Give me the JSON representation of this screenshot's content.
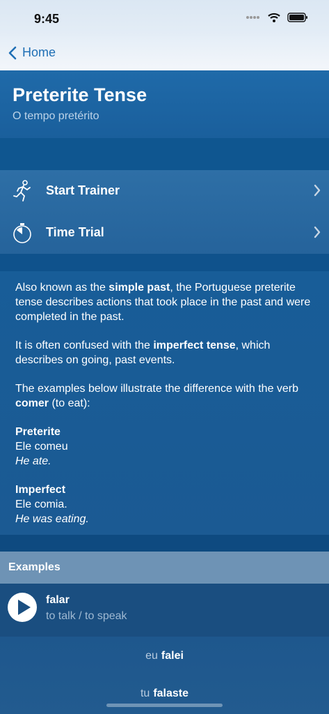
{
  "status": {
    "time": "9:45",
    "icons": [
      "signal-dots-icon",
      "wifi-icon",
      "battery-icon"
    ]
  },
  "nav": {
    "back_label": "Home",
    "back_icon": "chevron-left-icon"
  },
  "header": {
    "title": "Preterite Tense",
    "subtitle": "O tempo pretérito"
  },
  "menu": {
    "items": [
      {
        "label": "Start Trainer",
        "icon": "runner-icon"
      },
      {
        "label": "Time Trial",
        "icon": "stopwatch-icon"
      }
    ]
  },
  "description": {
    "p1": {
      "a": "Also known as the ",
      "b": "simple past",
      "c": ", the Portuguese preterite tense describes actions that took place in the past and were completed in the past."
    },
    "p2": {
      "a": "It is often confused with the ",
      "b": "imperfect tense",
      "c": ", which describes on going, past events."
    },
    "p3": {
      "a": "The examples below illustrate the difference with the verb ",
      "b": "comer",
      "c": " (to eat):"
    },
    "preterite": {
      "heading": "Preterite",
      "example": "Ele comeu",
      "translation": "He ate."
    },
    "imperfect": {
      "heading": "Imperfect",
      "example": "Ele comia.",
      "translation": "He was eating."
    }
  },
  "examples": {
    "header": "Examples",
    "verb": "falar",
    "translation": "to talk / to speak",
    "conjugations": [
      {
        "pronoun": "eu",
        "form": "falei"
      },
      {
        "pronoun": "tu",
        "form": "falaste"
      }
    ]
  },
  "colors": {
    "accent": "#1f6fb5",
    "background": "#1d5387",
    "examples_header": "#6e93b5"
  }
}
